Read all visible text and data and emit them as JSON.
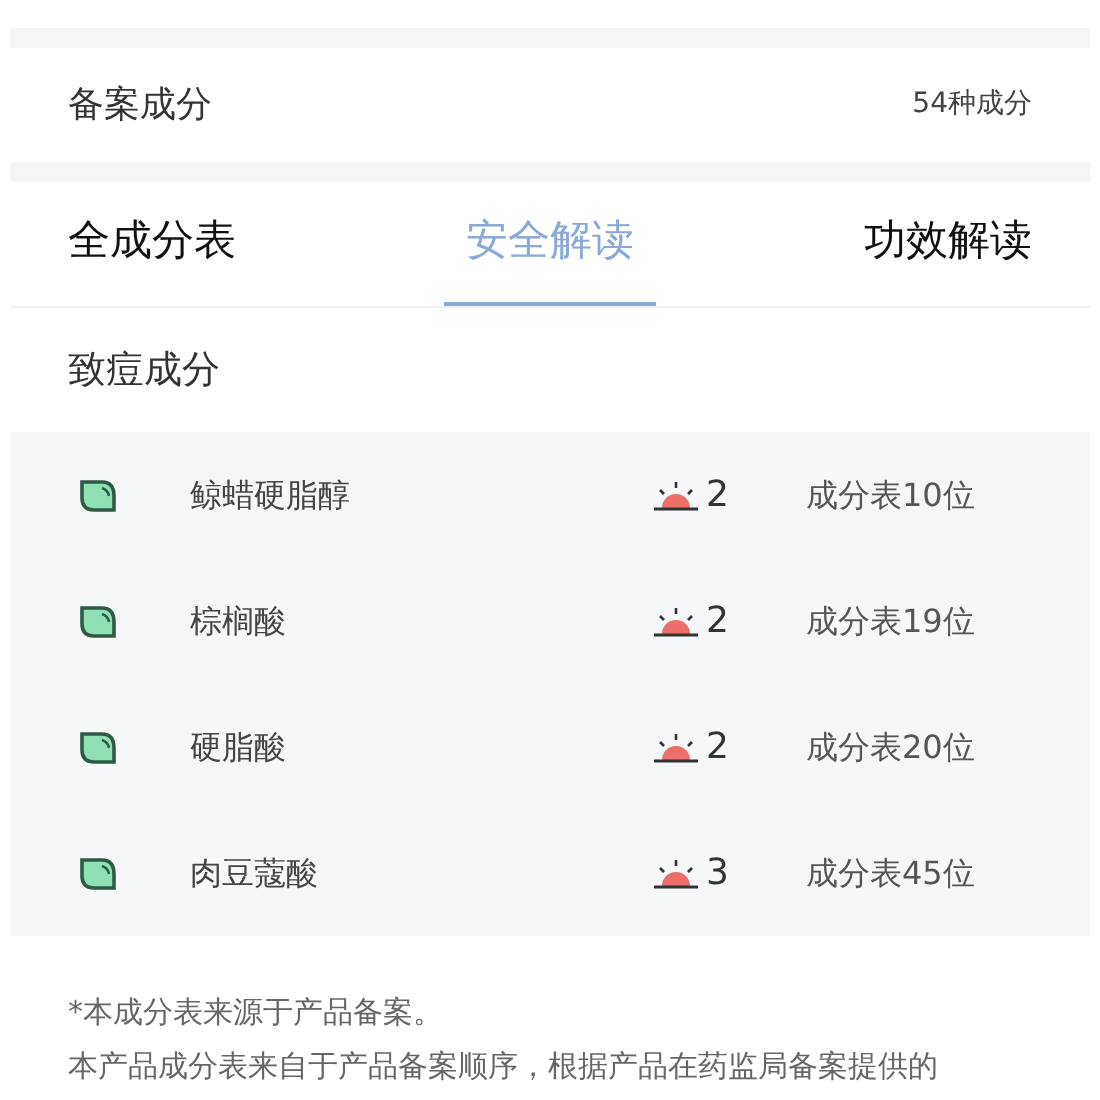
{
  "summary": {
    "label": "备案成分",
    "count": "54种成分"
  },
  "tabs": [
    {
      "label": "全成分表",
      "selected": false
    },
    {
      "label": "安全解读",
      "selected": true
    },
    {
      "label": "功效解读",
      "selected": false
    }
  ],
  "section_title": "致痘成分",
  "ingredients": [
    {
      "name": "鲸蜡硬脂醇",
      "risk": "2",
      "position": "成分表10位"
    },
    {
      "name": "棕榈酸",
      "risk": "2",
      "position": "成分表19位"
    },
    {
      "name": "硬脂酸",
      "risk": "2",
      "position": "成分表20位"
    },
    {
      "name": "肉豆蔻酸",
      "risk": "3",
      "position": "成分表45位"
    }
  ],
  "footnote": "*本成分表来源于产品备案。",
  "description": "本产品成分表来自于产品备案顺序，根据产品在药监局备案提供的"
}
